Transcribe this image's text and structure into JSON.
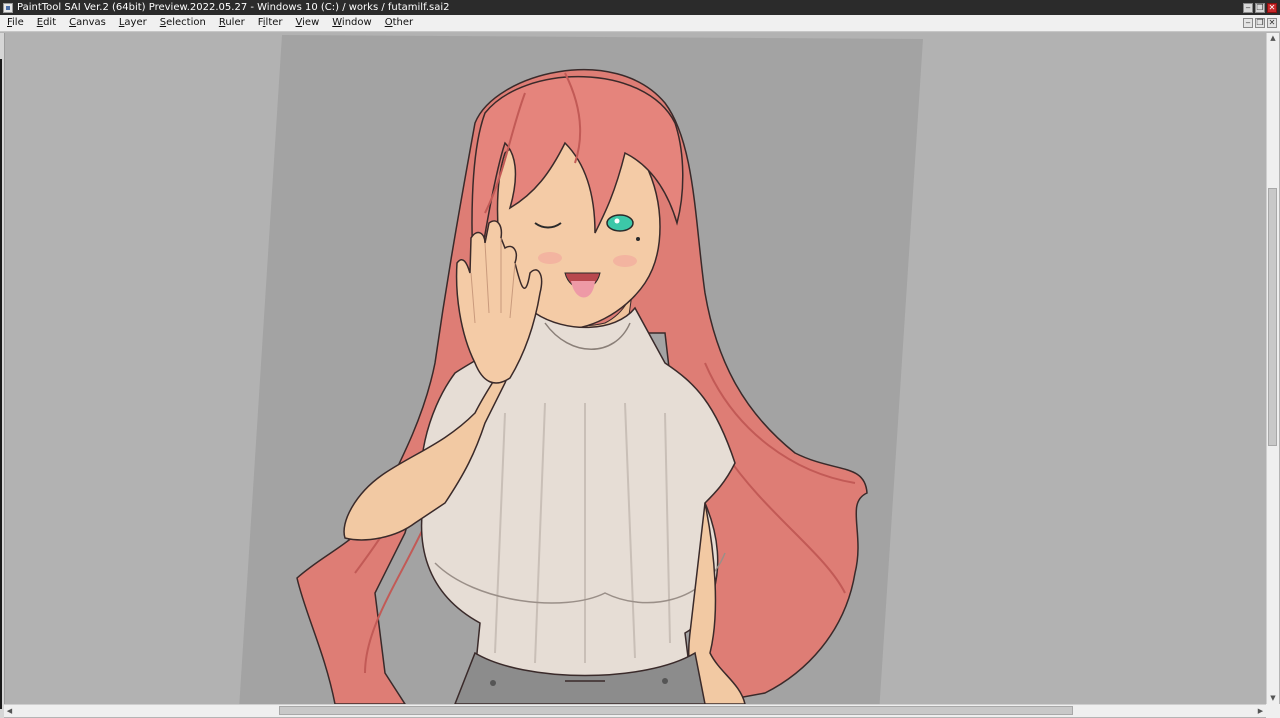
{
  "window": {
    "title": "PaintTool SAI Ver.2 (64bit) Preview.2022.05.27 - Windows 10 (C:) / works / futamilf.sai2",
    "buttons": {
      "minimize": "‒",
      "restore": "❐",
      "close": "✕"
    }
  },
  "menu": {
    "items": [
      {
        "label": "File",
        "mnemonic": "F",
        "rest": "ile"
      },
      {
        "label": "Edit",
        "mnemonic": "E",
        "rest": "dit"
      },
      {
        "label": "Canvas",
        "mnemonic": "C",
        "rest": "anvas"
      },
      {
        "label": "Layer",
        "mnemonic": "L",
        "rest": "ayer"
      },
      {
        "label": "Selection",
        "mnemonic": "S",
        "rest": "election"
      },
      {
        "label": "Ruler",
        "mnemonic": "R",
        "rest": "uler"
      },
      {
        "label": "Filter",
        "mnemonic": "F",
        "rest": "ilter"
      },
      {
        "label": "View",
        "mnemonic": "V",
        "rest": "iew"
      },
      {
        "label": "Window",
        "mnemonic": "W",
        "rest": "indow"
      },
      {
        "label": "Other",
        "mnemonic": "O",
        "rest": "ther"
      }
    ],
    "mdi_buttons": {
      "minimize": "‒",
      "restore": "❐",
      "close": "✕"
    }
  },
  "canvas": {
    "artwork": "illustration-character-rotated-canvas",
    "colors": {
      "workspace": "#b2b2b2",
      "paper": "#a3a3a3",
      "hair": "#e07f78",
      "hair_shade": "#c8615d",
      "skin": "#f2c9a3",
      "sweater": "#e6ddd5",
      "eye": "#3cc8a8",
      "lineart": "#3a2a2a"
    }
  },
  "scrollbars": {
    "vertical": {
      "up": "▲",
      "down": "▼"
    },
    "horizontal": {
      "left": "◀",
      "right": "▶"
    }
  }
}
